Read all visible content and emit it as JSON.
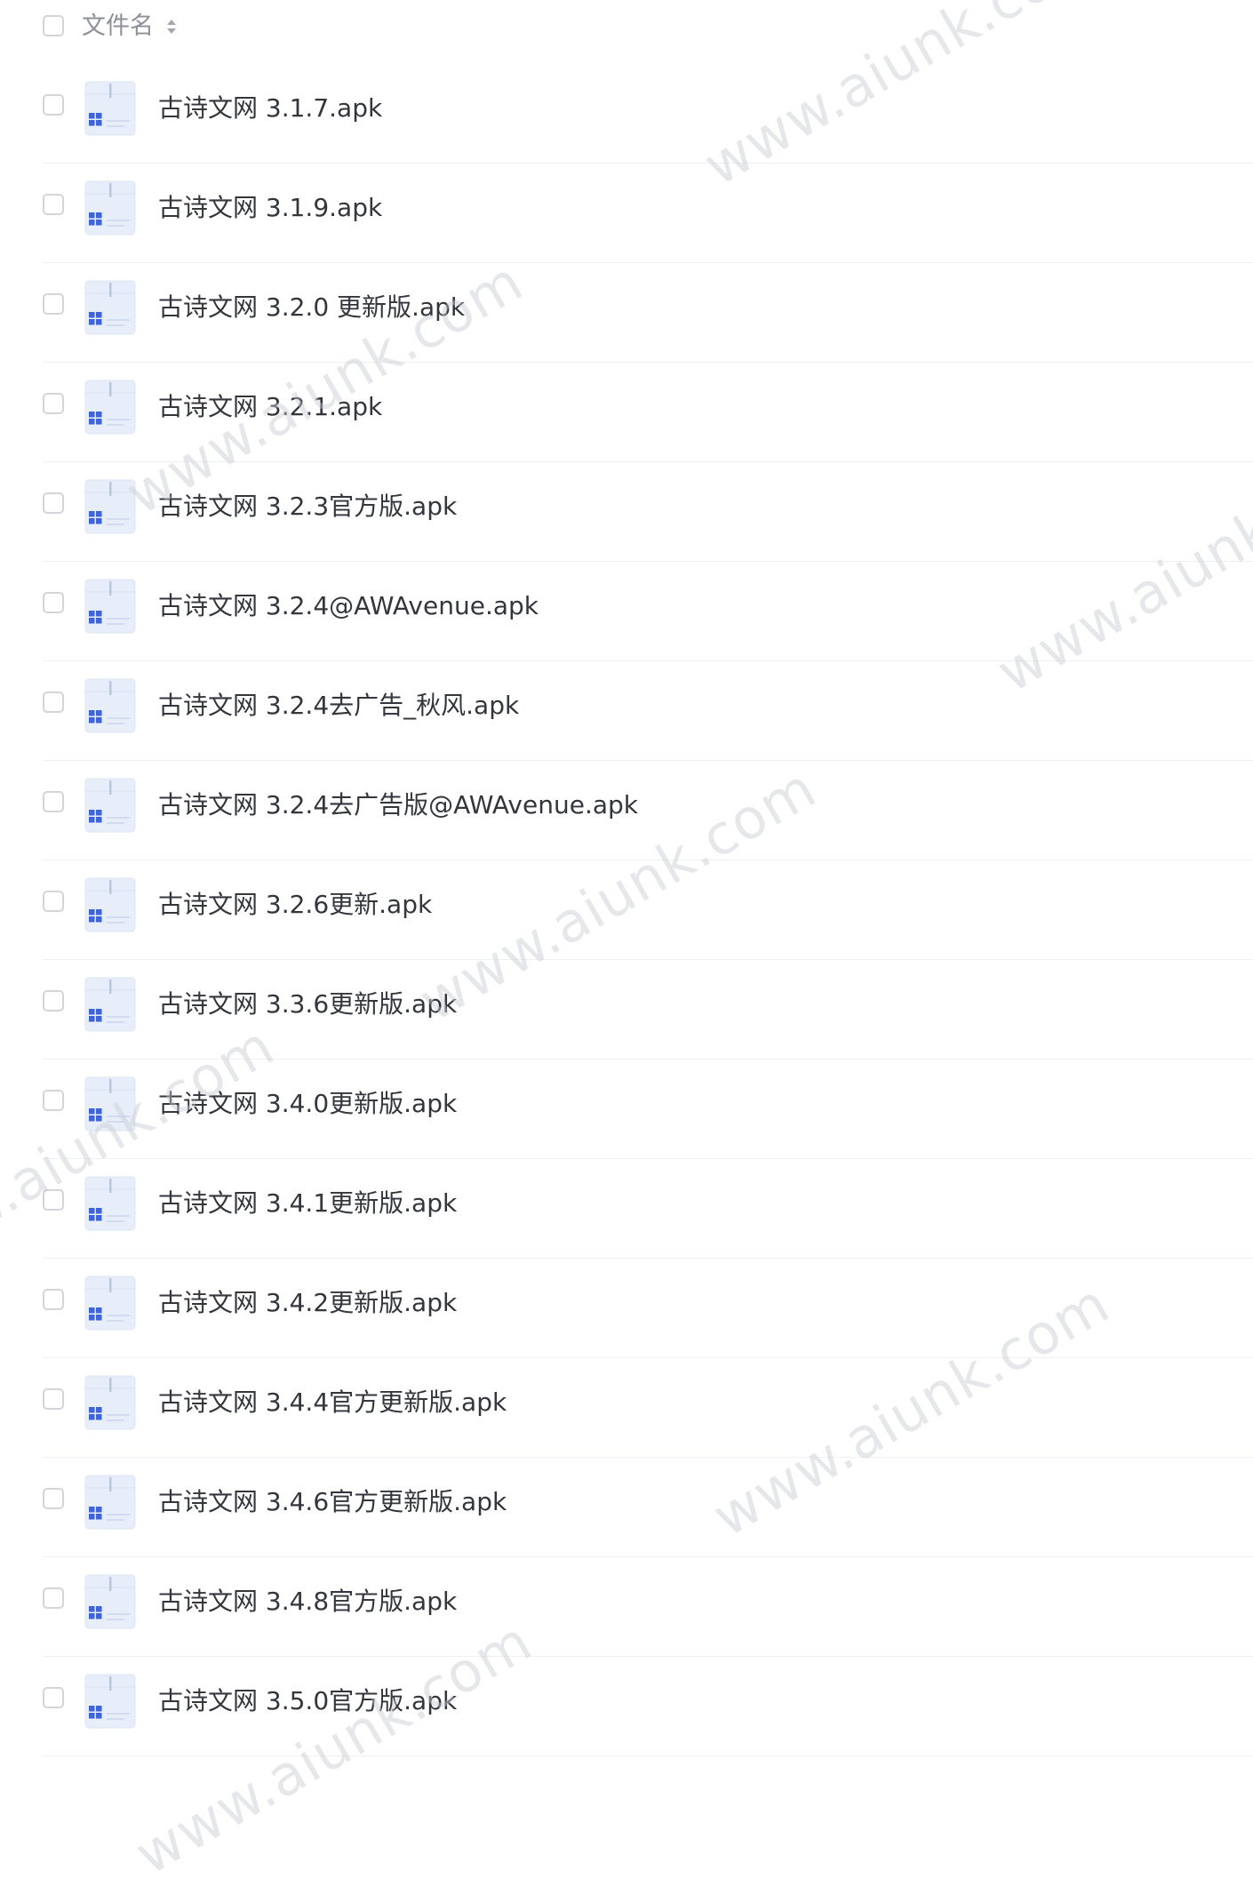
{
  "header": {
    "column_label": "文件名"
  },
  "files": [
    {
      "name": "古诗文网 3.1.7.apk"
    },
    {
      "name": "古诗文网 3.1.9.apk"
    },
    {
      "name": "古诗文网 3.2.0 更新版.apk"
    },
    {
      "name": "古诗文网 3.2.1.apk"
    },
    {
      "name": "古诗文网 3.2.3官方版.apk"
    },
    {
      "name": "古诗文网 3.2.4@AWAvenue.apk"
    },
    {
      "name": "古诗文网 3.2.4去广告_秋风.apk"
    },
    {
      "name": "古诗文网 3.2.4去广告版@AWAvenue.apk"
    },
    {
      "name": "古诗文网 3.2.6更新.apk"
    },
    {
      "name": "古诗文网 3.3.6更新版.apk"
    },
    {
      "name": "古诗文网 3.4.0更新版.apk"
    },
    {
      "name": "古诗文网 3.4.1更新版.apk"
    },
    {
      "name": "古诗文网 3.4.2更新版.apk"
    },
    {
      "name": "古诗文网 3.4.4官方更新版.apk"
    },
    {
      "name": "古诗文网 3.4.6官方更新版.apk"
    },
    {
      "name": "古诗文网 3.4.8官方版.apk"
    },
    {
      "name": "古诗文网 3.5.0官方版.apk"
    }
  ],
  "watermark_text": "www.aiunk.com",
  "colors": {
    "icon_blue": "#3a64e0",
    "icon_light": "#e8eef9",
    "divider": "#eef0f3"
  }
}
